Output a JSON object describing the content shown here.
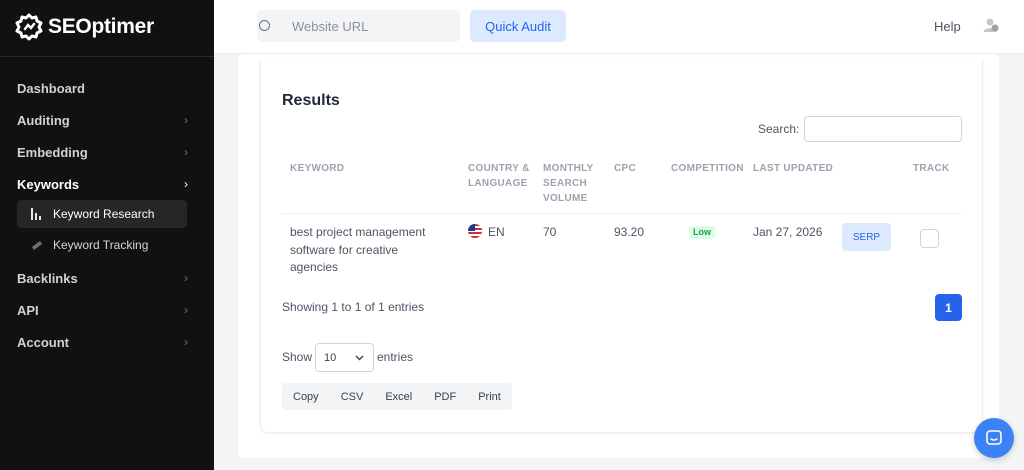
{
  "brand": {
    "logo_text": "SEOptimer"
  },
  "sidebar": {
    "items": [
      {
        "label": "Dashboard",
        "chevron": false
      },
      {
        "label": "Auditing",
        "chevron": true
      },
      {
        "label": "Embedding",
        "chevron": true
      },
      {
        "label": "Keywords",
        "chevron": true,
        "active": true
      },
      {
        "label": "Backlinks",
        "chevron": true
      },
      {
        "label": "API",
        "chevron": true
      },
      {
        "label": "Account",
        "chevron": true
      }
    ],
    "sub_items": [
      {
        "label": "Keyword Research",
        "icon": "bar-chart-icon",
        "active": true
      },
      {
        "label": "Keyword Tracking",
        "icon": "telescope-icon"
      }
    ]
  },
  "topbar": {
    "search_placeholder": "Website URL",
    "audit_label": "Quick Audit",
    "help_label": "Help"
  },
  "results": {
    "title": "Results",
    "search_label": "Search:",
    "columns": {
      "keyword": "KEYWORD",
      "country_line1": "COUNTRY &",
      "country_line2": "LANGUAGE",
      "volume_line1": "MONTHLY",
      "volume_line2": "SEARCH",
      "volume_line3": "VOLUME",
      "cpc": "CPC",
      "competition": "COMPETITION",
      "updated": "LAST UPDATED",
      "track": "TRACK"
    },
    "rows": [
      {
        "keyword_line1": "best project management",
        "keyword_line2": "software for creative",
        "keyword_line3": "agencies",
        "language": "EN",
        "volume": "70",
        "cpc": "93.20",
        "competition": "Low",
        "updated": "Jan 27, 2026",
        "serp_label": "SERP",
        "tracked": false
      }
    ],
    "entries_info": "Showing 1 to 1 of 1 entries",
    "current_page": "1",
    "show_label": "Show",
    "page_size": "10",
    "entries_label": "entries",
    "export_buttons": [
      "Copy",
      "CSV",
      "Excel",
      "PDF",
      "Print"
    ]
  },
  "colors": {
    "accent": "#2563eb",
    "sidebar_bg": "#111111",
    "badge_green": "#16a34a"
  }
}
